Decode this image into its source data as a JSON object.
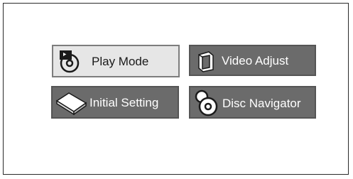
{
  "menu": {
    "items": [
      {
        "label": "Play Mode",
        "icon": "disc-play-icon",
        "selected": true
      },
      {
        "label": "Video Adjust",
        "icon": "video-adjust-icon",
        "selected": false
      },
      {
        "label": "Initial Setting",
        "icon": "setup-box-icon",
        "selected": false
      },
      {
        "label": "Disc Navigator",
        "icon": "disc-magnifier-icon",
        "selected": false
      }
    ]
  },
  "colors": {
    "selected_bg": "#e6e6e6",
    "normal_bg": "#6b6b6b",
    "frame": "#2a2a2a"
  }
}
